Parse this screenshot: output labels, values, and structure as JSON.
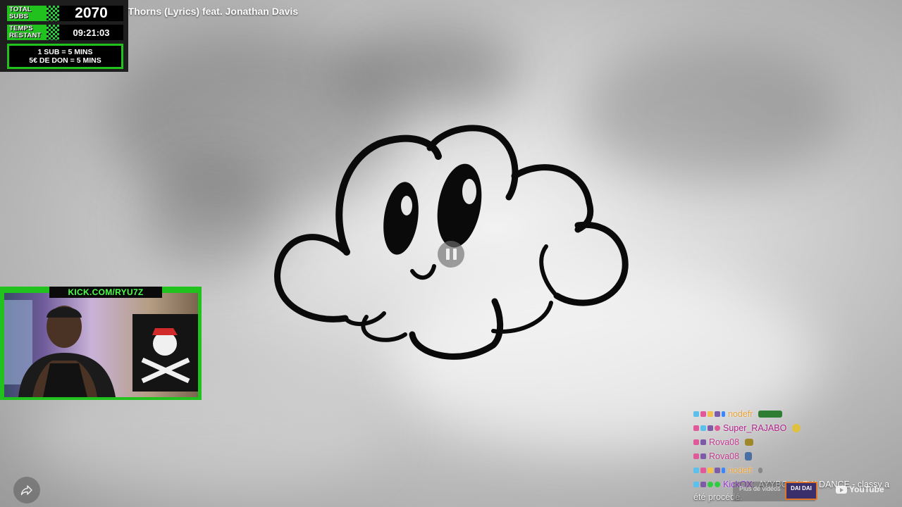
{
  "video": {
    "title": "y Thorns (Lyrics) feat. Jonathan Davis",
    "state_icon": "pause-icon"
  },
  "sub_timer": {
    "total_subs_label": "TOTAL\nSUBS",
    "total_subs_value": "2070",
    "time_label": "TEMPS\nRESTANT",
    "time_value": "09:21:03",
    "rule_sub": "1 SUB = 5 MINS",
    "rule_don": "5€ DE DON = 5 MINS",
    "accent": "#21c21e"
  },
  "webcam": {
    "banner": "KICK.COM/RYU7Z"
  },
  "chat": {
    "messages": [
      {
        "name": "nodefr",
        "color": "#e8a13a",
        "text": "",
        "badges": [
          "#5bc0eb",
          "#e05a9a",
          "#f2c14e",
          "#7d5ba6",
          "#3a86ff"
        ],
        "emote": "#2e7d32"
      },
      {
        "name": "Super_RAJABO",
        "color": "#b0208a",
        "text": "",
        "badges": [
          "#e05a9a",
          "#5bc0eb",
          "#7d5ba6",
          "#e05a9a"
        ],
        "emote": "#e0c040"
      },
      {
        "name": "Rova08",
        "color": "#c2388f",
        "text": "",
        "badges": [
          "#e05a9a",
          "#7d5ba6"
        ],
        "emote": "#a0882a"
      },
      {
        "name": "Rova08",
        "color": "#c2388f",
        "text": "",
        "badges": [
          "#e05a9a",
          "#7d5ba6"
        ],
        "emote": "#4a6fa5"
      },
      {
        "name": "nodefr",
        "color": "#e8a13a",
        "text": "",
        "badges": [
          "#5bc0eb",
          "#e05a9a",
          "#f2c14e",
          "#7d5ba6",
          "#3a86ff"
        ],
        "emote": "#888888"
      },
      {
        "name": "KickOX:",
        "color": "#9b30d9",
        "text": "AYYBO - NEW DANCE - classy a",
        "badges": [
          "#5bc0eb",
          "#7d5ba6",
          "#2ecc40",
          "#2ecc40"
        ],
        "emote": ""
      }
    ],
    "continuation": "été procédé."
  },
  "youtube": {
    "more_videos": "Plus de vidéos",
    "thumb_label": "DAI DAI",
    "logo_text": "YouTube"
  }
}
